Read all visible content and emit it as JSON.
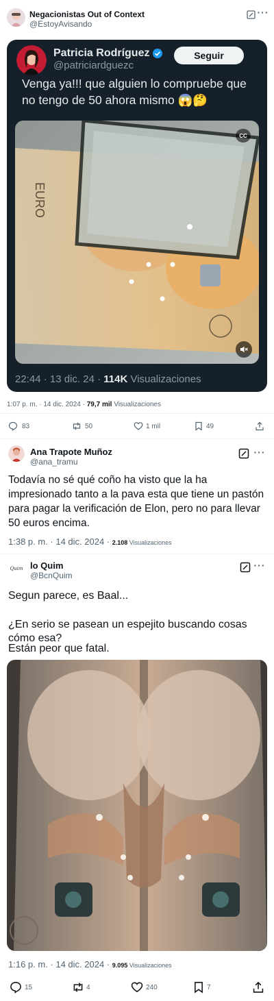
{
  "header": {
    "name": "Negacionistas Out of Context",
    "handle": "@EstoyAvisando"
  },
  "embed": {
    "name": "Patricia Rodríguez",
    "handle": "@patriciardguezc",
    "follow_label": "Seguir",
    "text": "Venga ya!!! que alguien lo compruebe que no tengo de 50 ahora mismo 😱🤔",
    "time": "22:44 · 13 dic. 24 · ",
    "views": "114K",
    "views_label": " Visualizaciones",
    "cc_label": "CC"
  },
  "main_meta": {
    "time": "1:07 p. m. · 14 dic. 2024 · ",
    "views": "79,7 mil",
    "views_label": " Visualizaciones"
  },
  "main_actions": {
    "replies": "83",
    "reposts": "50",
    "likes": "1 mil",
    "bookmarks": "49"
  },
  "reply1": {
    "name": "Ana Trapote Muñoz",
    "handle": "@ana_tramu",
    "text": "Todavía no sé qué coño ha visto que la ha impresionado tanto a la pava esta que tiene un pastón para pagar la verificación de Elon, pero no para llevar 50 euros encima.",
    "time": "1:38 p. m. · 14 dic. 2024 · ",
    "views": "2.108",
    "views_label": " Visualizaciones"
  },
  "reply2": {
    "name": "lo Quim",
    "handle": "@BcnQuim",
    "avatar_text": "Quim",
    "text1": "Segun parece, es Baal...",
    "text2": "¿En serio se pasean un espejito buscando cosas cómo esa?",
    "text3": "Están peor que fatal.",
    "time": "1:16 p. m. · 14 dic. 2024 · ",
    "views": "9.095",
    "views_label": " Visualizaciones",
    "actions": {
      "replies": "15",
      "reposts": "4",
      "likes": "240",
      "bookmarks": "7"
    }
  },
  "colors": {
    "card_bg": "#15202b",
    "verified": "#1d9bf0",
    "muted": "#536471"
  }
}
